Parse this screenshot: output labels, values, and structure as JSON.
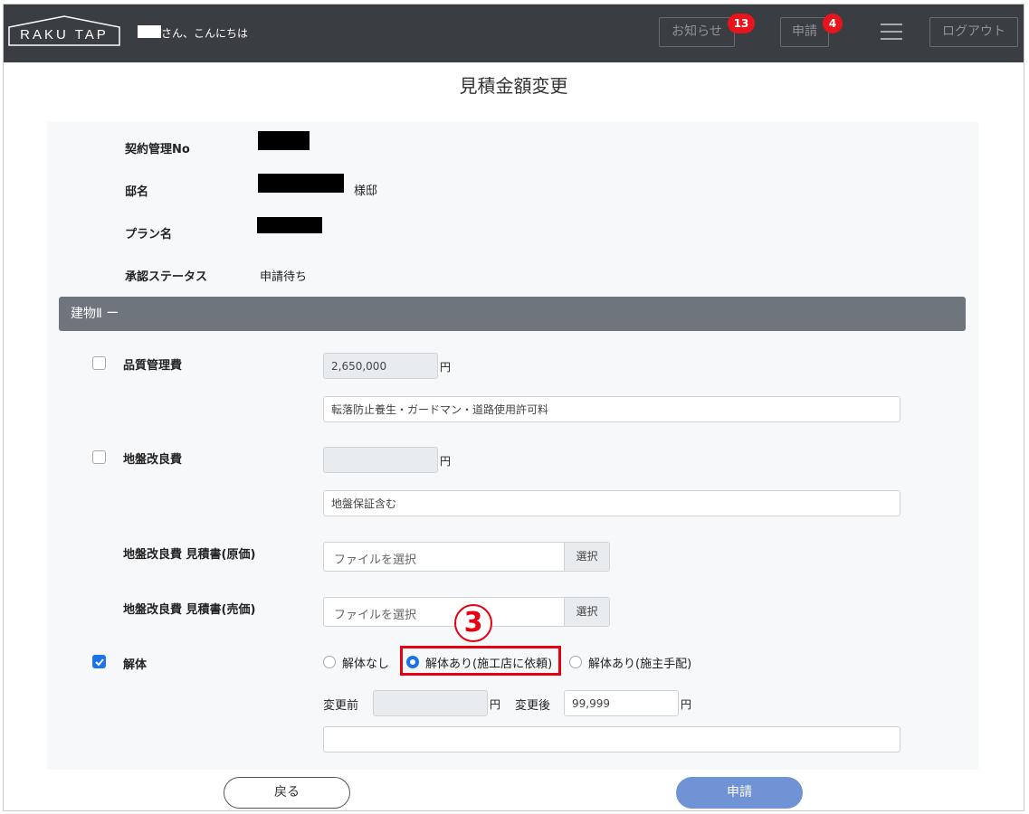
{
  "header": {
    "logo_text": "RAKU TAP",
    "greeting": "さん、こんにちは",
    "notice_label": "お知らせ",
    "notice_badge": "13",
    "apply_label": "申請",
    "apply_badge": "4",
    "logout_label": "ログアウト"
  },
  "page": {
    "title": "見積金額変更"
  },
  "info": {
    "contract_no_label": "契約管理No",
    "house_name_label": "邸名",
    "house_name_suffix": "様邸",
    "plan_name_label": "プラン名",
    "approval_status_label": "承認ステータス",
    "approval_status_value": "申請待ち"
  },
  "section": {
    "title": "建物Ⅱ ー"
  },
  "quality_fee": {
    "label": "品質管理費",
    "amount": "2,650,000",
    "unit": "円",
    "note": "転落防止養生・ガードマン・道路使用許可料",
    "checked": false
  },
  "ground_fee": {
    "label": "地盤改良費",
    "amount": "",
    "unit": "円",
    "note": "地盤保証含む",
    "checked": false
  },
  "ground_estimate_cost": {
    "label": "地盤改良費 見積書(原価)",
    "placeholder": "ファイルを選択",
    "button": "選択"
  },
  "ground_estimate_sale": {
    "label": "地盤改良費 見積書(売価)",
    "placeholder": "ファイルを選択",
    "button": "選択"
  },
  "demolition": {
    "label": "解体",
    "checked": true,
    "options": [
      "解体なし",
      "解体あり(施工店に依頼)",
      "解体あり(施主手配)"
    ],
    "selected": "解体あり(施工店に依頼)",
    "before_label": "変更前",
    "before_value": "",
    "after_label": "変更後",
    "after_value": "99,999",
    "unit": "円",
    "note": ""
  },
  "annotation": {
    "step": "3"
  },
  "footer": {
    "back_label": "戻る",
    "submit_label": "申請"
  },
  "colors": {
    "header_bg": "#3a3d42",
    "section_bg": "#6e757c",
    "badge": "#e8141c",
    "accent": "#1a73e8",
    "submit": "#6f93d4",
    "highlight": "#e60012"
  }
}
